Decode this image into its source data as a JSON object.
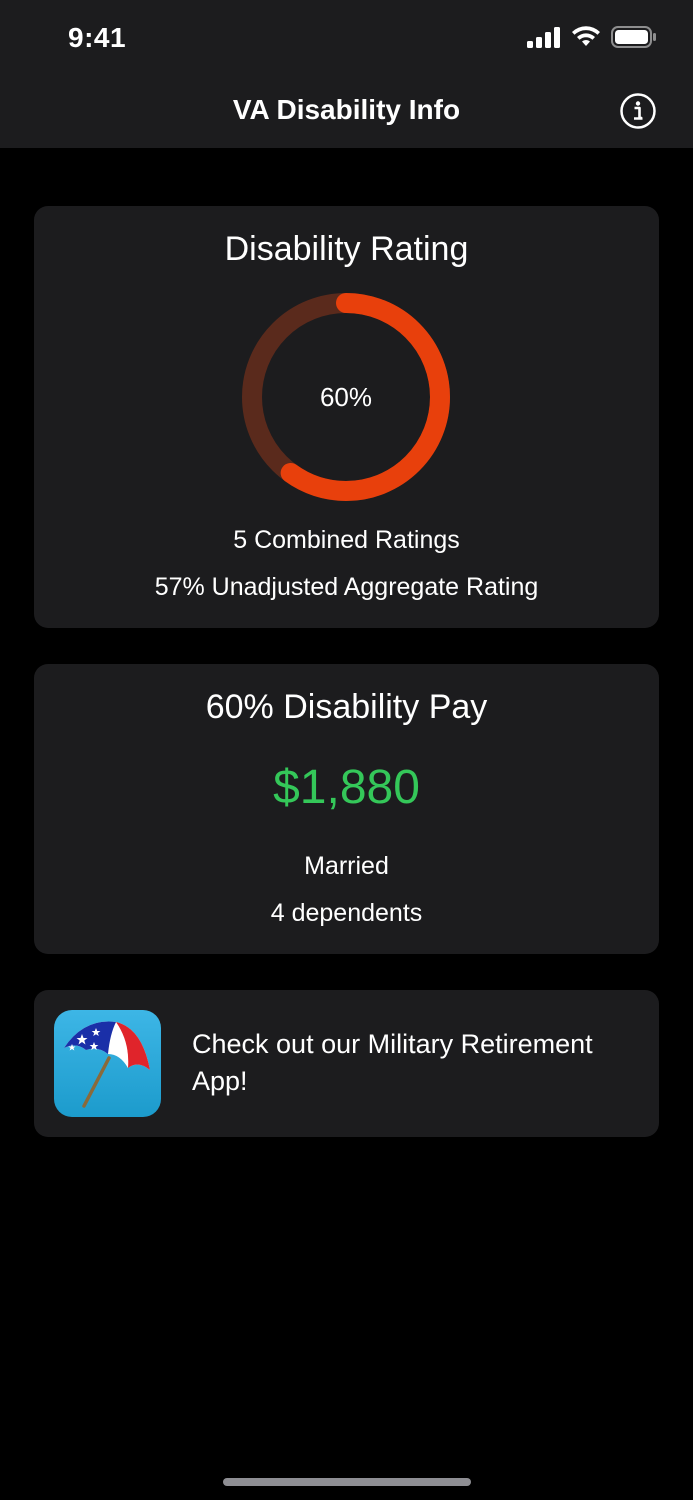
{
  "status_bar": {
    "time": "9:41",
    "icons": [
      "signal-icon",
      "wifi-icon",
      "battery-icon"
    ]
  },
  "nav": {
    "title": "VA Disability Info",
    "info_icon": "info-icon"
  },
  "rating_card": {
    "title": "Disability Rating",
    "rating_percent": 60,
    "rating_label": "60%",
    "combined_ratings": "5 Combined Ratings",
    "aggregate": "57% Unadjusted Aggregate Rating",
    "ring_color": "#e8400c",
    "ring_track_color": "#5a2a1c"
  },
  "pay_card": {
    "title": "60% Disability Pay",
    "amount": "$1,880",
    "amount_color": "#34c759",
    "marital_status": "Married",
    "dependents": "4 dependents"
  },
  "promo_card": {
    "text": "Check out our Military Retirement App!",
    "icon": "umbrella-icon"
  }
}
